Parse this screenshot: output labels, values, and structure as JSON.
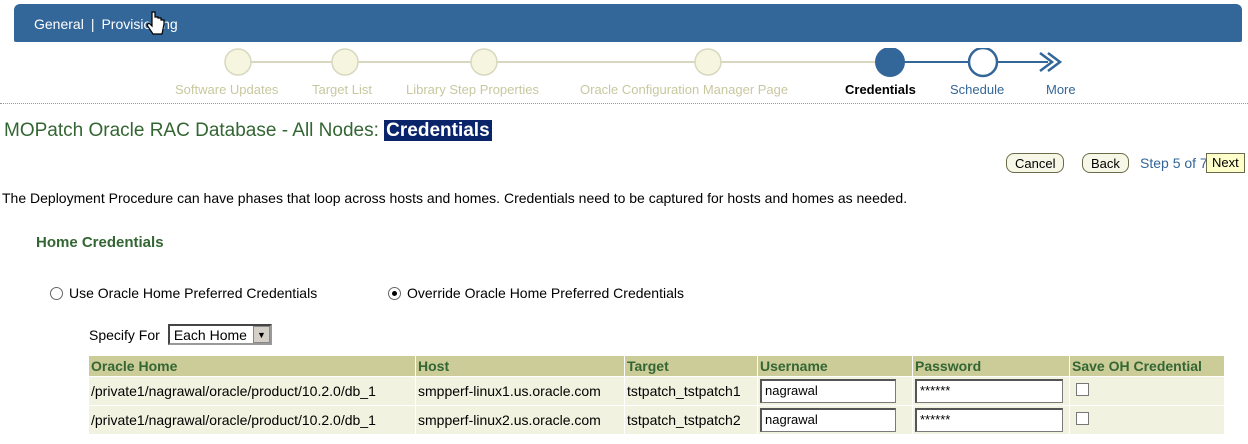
{
  "header": {
    "tabs": [
      "General",
      "Provisioning"
    ]
  },
  "train": {
    "steps": [
      {
        "label": "Software Updates",
        "state": "visited"
      },
      {
        "label": "Target List",
        "state": "visited"
      },
      {
        "label": "Library Step Properties",
        "state": "visited"
      },
      {
        "label": "Oracle Configuration Manager Page",
        "state": "visited"
      },
      {
        "label": "Credentials",
        "state": "current"
      },
      {
        "label": "Schedule",
        "state": "next"
      },
      {
        "label": "More",
        "state": "more"
      }
    ]
  },
  "page": {
    "title_prefix": "MOPatch Oracle RAC Database - All Nodes: ",
    "title_highlight": "Credentials",
    "description": "The Deployment Procedure can have phases that loop across hosts and homes. Credentials need to be captured for hosts and homes as needed."
  },
  "nav": {
    "cancel": "Cancel",
    "back": "Back",
    "step_info": "Step 5 of 7",
    "next": "Next"
  },
  "home_credentials": {
    "section_title": "Home Credentials",
    "option_use": "Use Oracle Home Preferred Credentials",
    "option_override": "Override Oracle Home Preferred Credentials",
    "selected_option": "override",
    "specify_for_label": "Specify For",
    "specify_for_value": "Each Home",
    "columns": [
      "Oracle Home",
      "Host",
      "Target",
      "Username",
      "Password",
      "Save OH Credential"
    ],
    "rows": [
      {
        "oracle_home": "/private1/nagrawal/oracle/product/10.2.0/db_1",
        "host": "smpperf-linux1.us.oracle.com",
        "target": "tstpatch_tstpatch1",
        "username": "nagrawal",
        "password": "******",
        "save": false
      },
      {
        "oracle_home": "/private1/nagrawal/oracle/product/10.2.0/db_1",
        "host": "smpperf-linux2.us.oracle.com",
        "target": "tstpatch_tstpatch2",
        "username": "nagrawal",
        "password": "******",
        "save": false
      }
    ]
  },
  "colors": {
    "header_bg": "#336699",
    "title_green": "#336633",
    "table_header_bg": "#cccc99",
    "link_blue": "#336699"
  }
}
